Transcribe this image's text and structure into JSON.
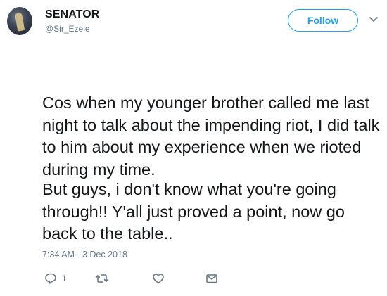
{
  "user": {
    "display_name": "SENATOR",
    "handle": "@Sir_Ezele"
  },
  "follow_button": {
    "label": "Follow"
  },
  "tweet": {
    "paragraph_1": "Cos when my younger brother called me last night to talk about the impending riot, I did talk to him about my experience when we rioted during my time.",
    "paragraph_2": "But guys, i don't know what you're going through!! Y'all just proved a point, now go back to the table..",
    "timestamp": "7:34 AM - 3 Dec 2018"
  },
  "actions": {
    "reply_count": "1"
  },
  "colors": {
    "accent": "#1da1f2",
    "muted": "#657786",
    "text": "#14171a"
  },
  "icons": [
    "avatar",
    "chevron-down-icon",
    "reply-icon",
    "retweet-icon",
    "heart-icon",
    "envelope-icon"
  ]
}
